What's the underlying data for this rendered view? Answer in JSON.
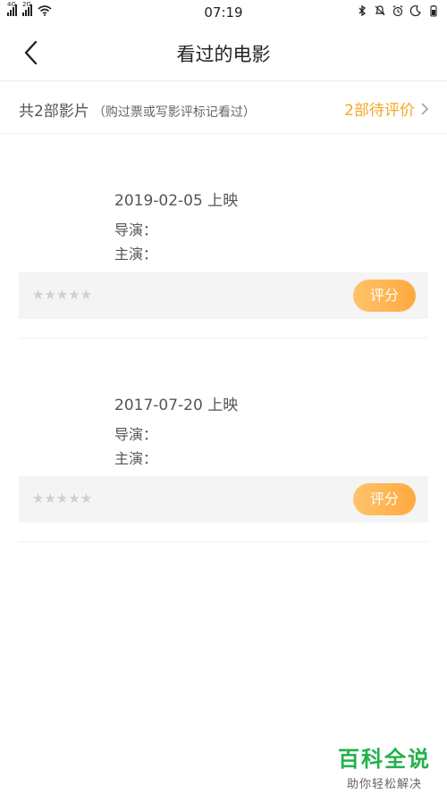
{
  "status_bar": {
    "time": "07:19",
    "sim1": "4G",
    "sim2": "2G"
  },
  "nav": {
    "title": "看过的电影"
  },
  "summary": {
    "count_text": "共2部影片",
    "note": "（购过票或写影评标记看过）",
    "pending": "2部待评价"
  },
  "movies": [
    {
      "release": "2019-02-05 上映",
      "director": "导演：",
      "actor": "主演：",
      "stars": "★★★★★",
      "rate_label": "评分"
    },
    {
      "release": "2017-07-20 上映",
      "director": "导演：",
      "actor": "主演：",
      "stars": "★★★★★",
      "rate_label": "评分"
    }
  ],
  "watermark": {
    "title": "百科全说",
    "subtitle": "助你轻松解决"
  },
  "colors": {
    "accent": "#f5a623",
    "watermark": "#22b14c"
  }
}
